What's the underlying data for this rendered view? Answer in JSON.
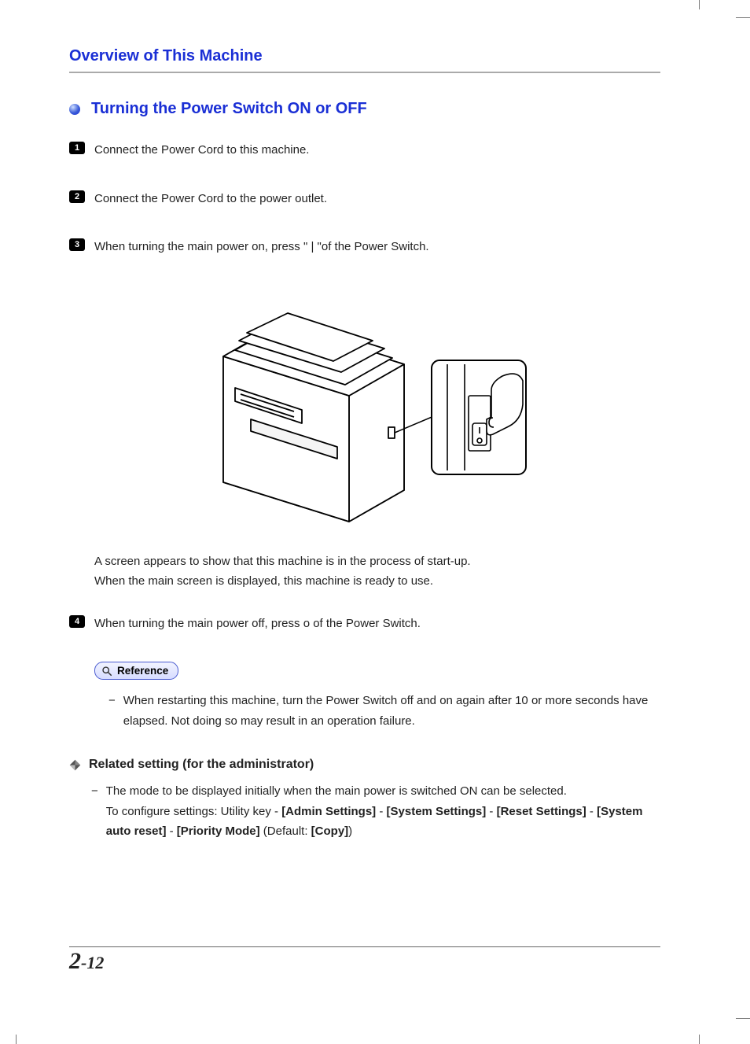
{
  "header": {
    "section_title": "Overview of This Machine"
  },
  "subsection": {
    "title": "Turning the Power Switch ON or OFF"
  },
  "steps": [
    {
      "num": "1",
      "text": "Connect the Power Cord to this machine."
    },
    {
      "num": "2",
      "text": "Connect the Power Cord to the power outlet."
    },
    {
      "num": "3",
      "text": "When turning the main power on, press \" | \"of the Power Switch."
    },
    {
      "num": "4",
      "text": "When turning the main power off, press o of the Power Switch."
    }
  ],
  "after_image": {
    "line1": "A screen appears to show that this machine is in the process of start-up.",
    "line2": "When the main screen is displayed, this machine is ready to use."
  },
  "reference": {
    "label": "Reference",
    "items": [
      "When restarting this machine, turn the Power Switch off and on again after 10 or more seconds have elapsed. Not doing so may result in an operation failure."
    ]
  },
  "related": {
    "title": "Related setting (for the administrator)",
    "item_lead": "The mode to be displayed initially when the main power is switched ON can be selected.",
    "config_prefix": "To configure settings: Utility key - ",
    "path": [
      "[Admin Settings]",
      "[System Settings]",
      "[Reset Settings]",
      "[System auto reset]",
      "[Priority Mode]"
    ],
    "sep": " - ",
    "default_prefix": " (Default: ",
    "default_value": "[Copy]",
    "default_suffix": ")"
  },
  "footer": {
    "chapter": "2",
    "page": "-12"
  }
}
